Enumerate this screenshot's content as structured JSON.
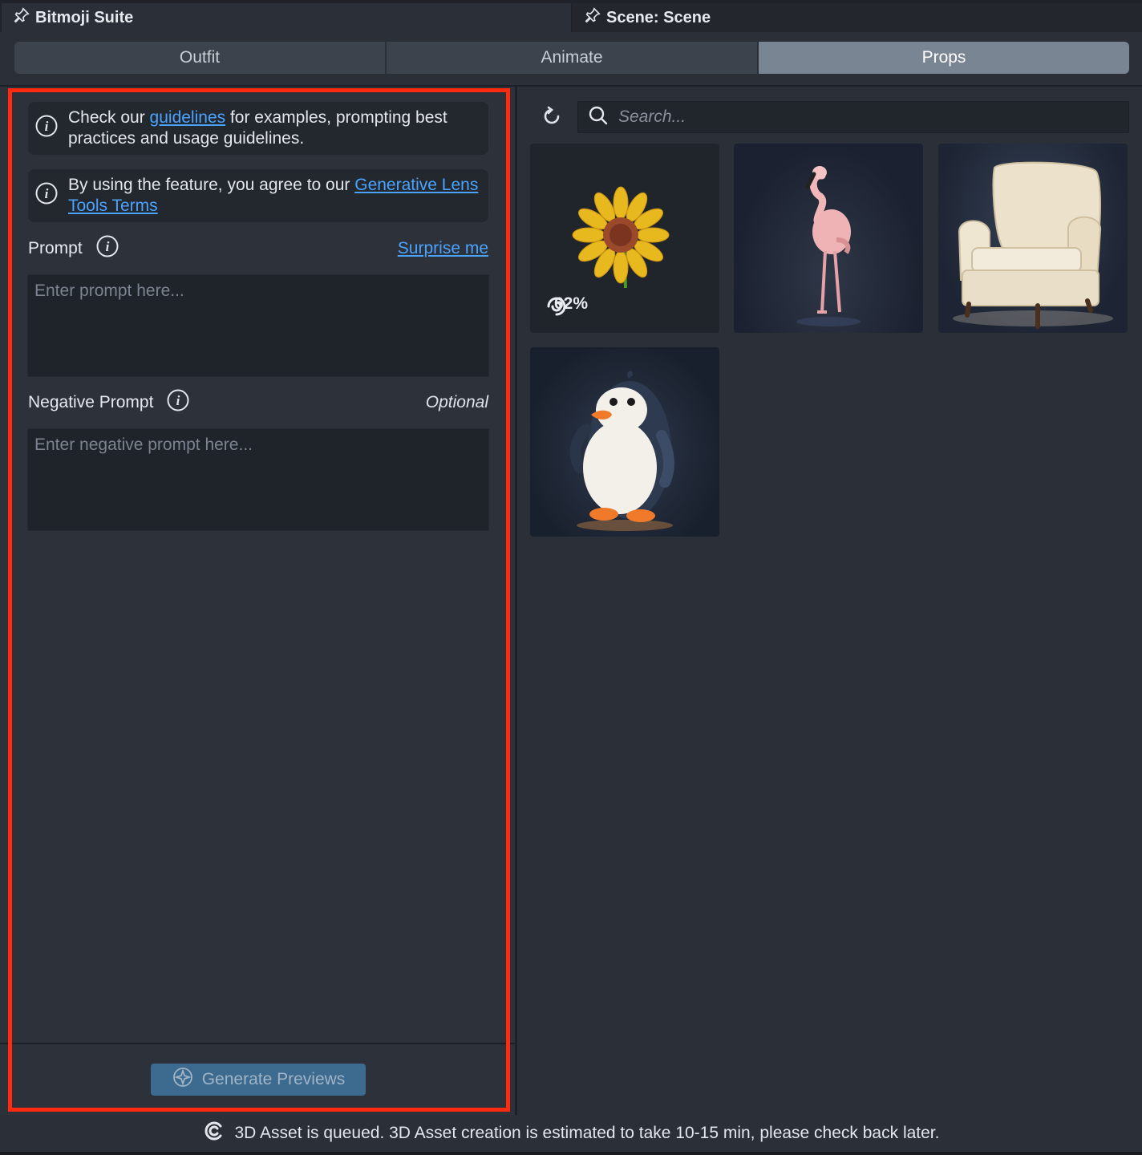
{
  "window_tabs": [
    {
      "label": "Bitmoji Suite",
      "icon": "pin-icon"
    },
    {
      "label": "Scene: Scene",
      "icon": "pin-icon"
    }
  ],
  "segments": [
    {
      "label": "Outfit",
      "active": false
    },
    {
      "label": "Animate",
      "active": false
    },
    {
      "label": "Props",
      "active": true
    }
  ],
  "info1": {
    "prefix": "Check our ",
    "link": "guidelines",
    "suffix": " for examples, prompting best practices and usage guidelines."
  },
  "info2": {
    "prefix": "By using the feature, you agree to our ",
    "link": "Generative Lens Tools Terms"
  },
  "prompt": {
    "label": "Prompt",
    "surprise": "Surprise me",
    "placeholder": "Enter prompt here..."
  },
  "negative": {
    "label": "Negative Prompt",
    "optional": "Optional",
    "placeholder": "Enter negative prompt here..."
  },
  "generate_button": "Generate Previews",
  "search": {
    "placeholder": "Search..."
  },
  "assets": [
    {
      "name": "sunflower",
      "progress": "62%"
    },
    {
      "name": "flamingo"
    },
    {
      "name": "armchair"
    },
    {
      "name": "penguin"
    }
  ],
  "status": "3D Asset is queued. 3D Asset creation is estimated to take 10-15 min, please check back later.",
  "colors": {
    "accent_link": "#4aa3ff",
    "highlight_border": "#ff2a10",
    "active_segment": "#7a8594",
    "generate_button": "#3d6a8f"
  }
}
